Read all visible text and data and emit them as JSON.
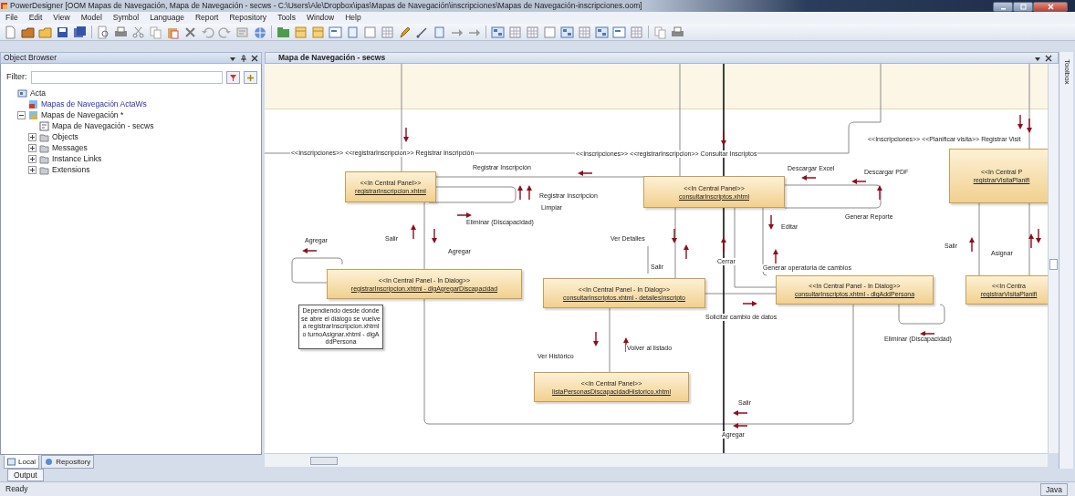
{
  "window": {
    "title": "PowerDesigner [OOM Mapas de Navegación, Mapa de Navegación - secws - C:\\Users\\Ale\\Dropbox\\ipas\\Mapas de Navegación\\inscripciones\\Mapas de Navegación-inscripciones.oom]"
  },
  "menu": [
    "File",
    "Edit",
    "View",
    "Model",
    "Symbol",
    "Language",
    "Report",
    "Repository",
    "Tools",
    "Window",
    "Help"
  ],
  "object_browser": {
    "title": "Object Browser",
    "filter_label": "Filter:",
    "tree": [
      {
        "label": "Acta",
        "kind": "workspace",
        "children": [
          {
            "label": "Mapas de Navegación ActaWs",
            "kind": "linked_model"
          },
          {
            "label": "Mapas de Navegación *",
            "kind": "model",
            "expanded": true,
            "children": [
              {
                "label": "Mapa de Navegación - secws",
                "kind": "diagram"
              },
              {
                "label": "Objects",
                "kind": "folder",
                "expanded": false
              },
              {
                "label": "Messages",
                "kind": "folder",
                "expanded": false
              },
              {
                "label": "Instance Links",
                "kind": "folder",
                "expanded": false
              },
              {
                "label": "Extensions",
                "kind": "folder",
                "expanded": false
              }
            ]
          }
        ]
      }
    ]
  },
  "browser_tabs": [
    {
      "label": "Local",
      "selected": true
    },
    {
      "label": "Repository",
      "selected": false
    }
  ],
  "diagram": {
    "title": "Mapa de Navegación - secws",
    "nodes": [
      {
        "stereotype": "<<In Central Panel>>",
        "name": "registrarInscripcion.xhtml"
      },
      {
        "stereotype": "<<In Central Panel>>",
        "name": "consultarInscriptos.xhtml"
      },
      {
        "stereotype": "<<In Central P",
        "name": "registrarVisitaPlanifi"
      },
      {
        "stereotype": "<<In Central Panel - In Dialog>>",
        "name": "registrarInscripcion.xhtml - dlgAgregarDiscapacidad"
      },
      {
        "stereotype": "<<In Central Panel - In Dialog>>",
        "name": "consultarInscriptos.xhtml - detallesInscripto"
      },
      {
        "stereotype": "<<In Central Panel - In Dialog>>",
        "name": "consultarInscriptos.xhtml - dlgAddPersona"
      },
      {
        "stereotype": "<<In Centra",
        "name": "registrarVisitaPlanifi"
      },
      {
        "stereotype": "<<In Central Panel>>",
        "name": "listaPersonasDiscapacidadHistorico.xhtml"
      }
    ],
    "note": "Dependiendo desde donde se abre el diálogo se vuelve a registrarInscripcion.xhtml o turnoAsignar.xhtml - dlgAddPersona",
    "labels": [
      "<<Inscripciones>> <<registrarInscripcion>>  Registrar Inscripción",
      "<<Inscripciones>> <<registrarInscripcion>>  Consultar Inscriptos",
      "<<Inscripciones>>  <<Planificar visita>>  Registrar Visit",
      "Registrar Inscripción",
      "Registrar Inscripcion",
      "Limpiar",
      "Eliminar (Discapacidad)",
      "Salir",
      "Agregar",
      "Agregar",
      "Ver Detalles",
      "Salir",
      "Descargar Excel",
      "Descargar PDF",
      "Generar Reporte",
      "Editar",
      "Cerrar",
      "Generar operatoria de cambios",
      "Salir",
      "Asignar",
      "Solicitar cambio de datos",
      "Eliminar (Discapacidad)",
      "Ver Histórico",
      "Volver al listado",
      "Salir",
      "Agregar"
    ]
  },
  "toolbox": {
    "label": "Toolbox"
  },
  "output_tab": {
    "label": "Output"
  },
  "status_bar": {
    "message": "Ready",
    "language": "Java"
  }
}
